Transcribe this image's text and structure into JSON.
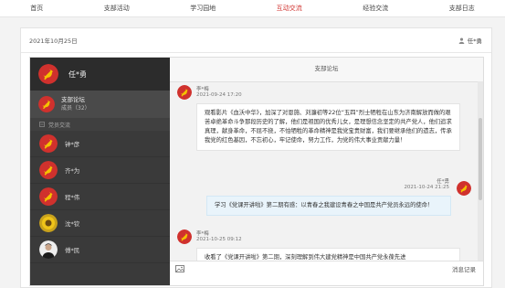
{
  "nav": {
    "items": [
      {
        "label": "首页",
        "active": false
      },
      {
        "label": "支部活动",
        "active": false
      },
      {
        "label": "学习园地",
        "active": false
      },
      {
        "label": "互动交流",
        "active": true
      },
      {
        "label": "经验交流",
        "active": false
      },
      {
        "label": "支部日志",
        "active": false
      }
    ]
  },
  "header": {
    "date": "2021年10月25日",
    "user": "任*勇"
  },
  "sidebar": {
    "me": "任*勇",
    "forum": {
      "title": "支部论坛",
      "sub": "成员（32）"
    },
    "group_label": "党员交流",
    "members": [
      {
        "name": "钟*彦",
        "avatar": "party-emblem"
      },
      {
        "name": "齐*为",
        "avatar": "party-emblem"
      },
      {
        "name": "程*伟",
        "avatar": "party-emblem"
      },
      {
        "name": "沈*钦",
        "avatar": "sunflower"
      },
      {
        "name": "傅*民",
        "avatar": "portrait"
      }
    ]
  },
  "chat": {
    "title": "支部论坛",
    "history": "消息记录",
    "messages": [
      {
        "sender": "李*梅",
        "time": "2021-09-24 17:20",
        "text": "观看影片《血沃中华》，加深了对恩施、刘濂初等22位“五四”烈士牺牲在山东为济南解放而做的艰苦卓绝革命斗争那段历史的了解，他们是祖国的优秀儿女，是理想信念坚定的共产党人，他们追求真理，献身革命，不屈不挠，不怕牺牲的革命精神是我党宝贵财富，我们要继承他们的遗志，传承我党的红色基因，不忘初心，牢记使命，努力工作，为党的伟大事业贡献力量！"
      },
      {
        "sender": "任*勇",
        "time": "2021-10-24 21:25",
        "text": "学习《党课开讲啦》第二期有感：以青春之我建设青春之中国是共产党员永远的使命！"
      },
      {
        "sender": "李*梅",
        "time": "2021-10-25 09:12",
        "text": "收看了《党课开讲啦》第二期，深刻理解到伟大建党精神是中国共产党永葆先进"
      }
    ]
  },
  "colors": {
    "party_red": "#d0312d",
    "star_gold": "#f5c400",
    "sidebar": "#3a3a3a",
    "accent": "#d0312d"
  }
}
